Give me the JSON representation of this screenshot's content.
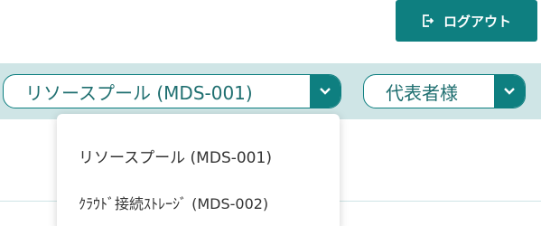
{
  "header": {
    "logout_label": "ログアウト"
  },
  "filters": {
    "resource_select": {
      "selected": "リソースプール (MDS-001)",
      "options": [
        "リソースプール (MDS-001)",
        "ｸﾗｳﾄﾞ接続ｽﾄﾚｰｼﾞ (MDS-002)"
      ]
    },
    "user_select": {
      "selected": "代表者様"
    }
  },
  "colors": {
    "accent": "#0e7f80",
    "bar_background": "#cfe5e6"
  },
  "icons": {
    "logout": "logout-icon",
    "chevron": "chevron-down-icon"
  }
}
